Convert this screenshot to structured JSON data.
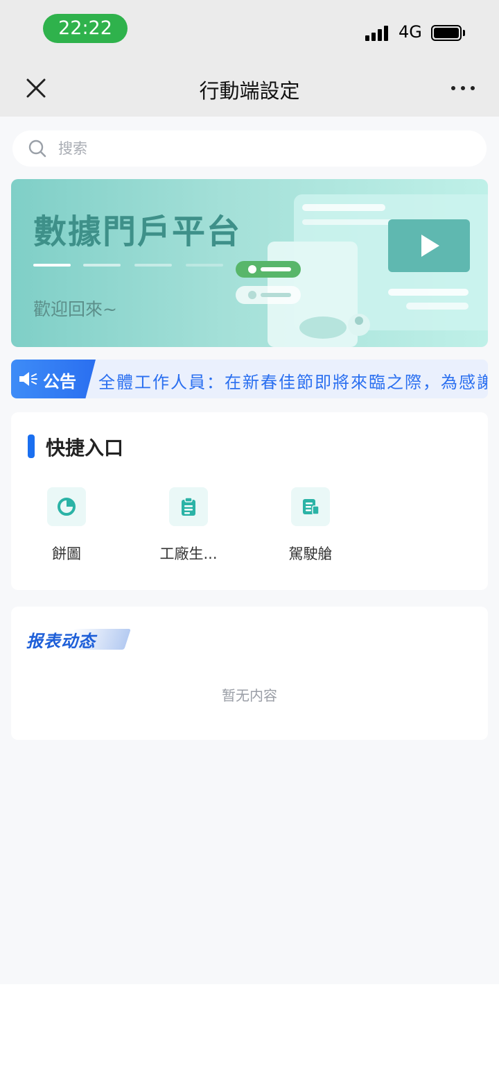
{
  "status_bar": {
    "time": "22:22",
    "network": "4G"
  },
  "nav": {
    "title": "行動端設定"
  },
  "search": {
    "placeholder": "搜索"
  },
  "banner": {
    "title": "數據門戶平台",
    "subtitle": "歡迎回來~"
  },
  "notice": {
    "tag_label": "公告",
    "text": "全體工作人員：在新春佳節即將來臨之際，為感謝"
  },
  "quick_entry": {
    "title": "快捷入口",
    "items": [
      {
        "label": "餅圖",
        "icon": "pie-chart-icon"
      },
      {
        "label": "工廠生...",
        "icon": "clipboard-icon"
      },
      {
        "label": "駕駛艙",
        "icon": "report-doc-icon"
      }
    ]
  },
  "report": {
    "title": "报表动态",
    "empty_text": "暂无内容"
  },
  "colors": {
    "accent_blue": "#1a6ff0",
    "status_green": "#2fb24c",
    "icon_teal": "#2bb3a6"
  }
}
